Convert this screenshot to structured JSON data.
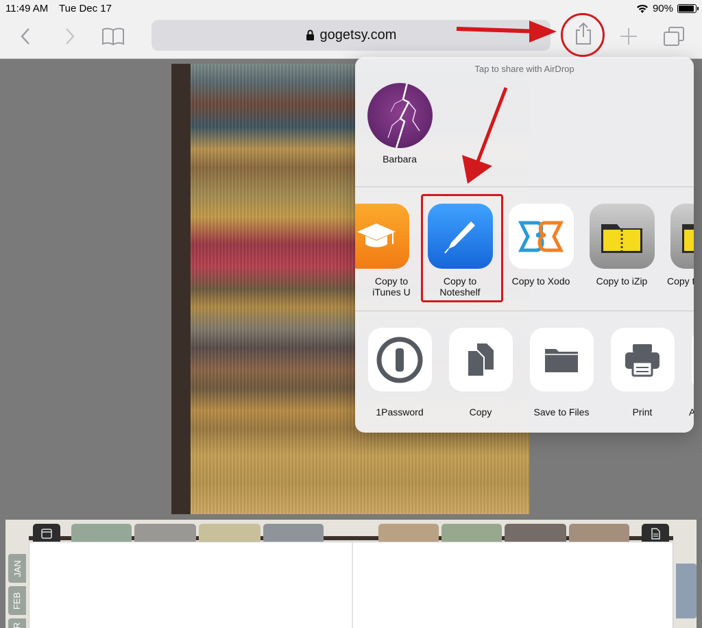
{
  "status_bar": {
    "time": "11:49 AM",
    "date": "Tue Dec 17",
    "battery": "90%",
    "battery_level": 0.9
  },
  "toolbar": {
    "url": "gogetsy.com",
    "icons": [
      "chevron-left-icon",
      "chevron-right-icon",
      "bookmarks-icon",
      "lock-icon",
      "reload-icon",
      "share-icon",
      "plus-icon",
      "tabs-icon"
    ]
  },
  "share_sheet": {
    "airdrop_hint": "Tap to share with AirDrop",
    "airdrop_contacts": [
      {
        "name": "Barbara"
      }
    ],
    "apps": [
      {
        "label": "Copy to iTunes U",
        "line1": "Copy to",
        "line2": "iTunes U"
      },
      {
        "label": "Copy to Noteshelf",
        "line1": "Copy to",
        "line2": "Noteshelf"
      },
      {
        "label": "Copy to Xodo"
      },
      {
        "label": "Copy to iZip"
      },
      {
        "label": "Copy t"
      }
    ],
    "actions": [
      {
        "label": "1Password"
      },
      {
        "label": "Copy"
      },
      {
        "label": "Save to Files"
      },
      {
        "label": "Print"
      },
      {
        "label": "A"
      }
    ]
  },
  "planner": {
    "month_tabs": [
      {
        "label": "JAN"
      },
      {
        "label": "FEB"
      },
      {
        "label": "R"
      }
    ]
  },
  "colors": {
    "annotation": "#d2191d",
    "noteshelf_blue": "#1f7fe6",
    "itunes_orange": "#f7941d"
  }
}
